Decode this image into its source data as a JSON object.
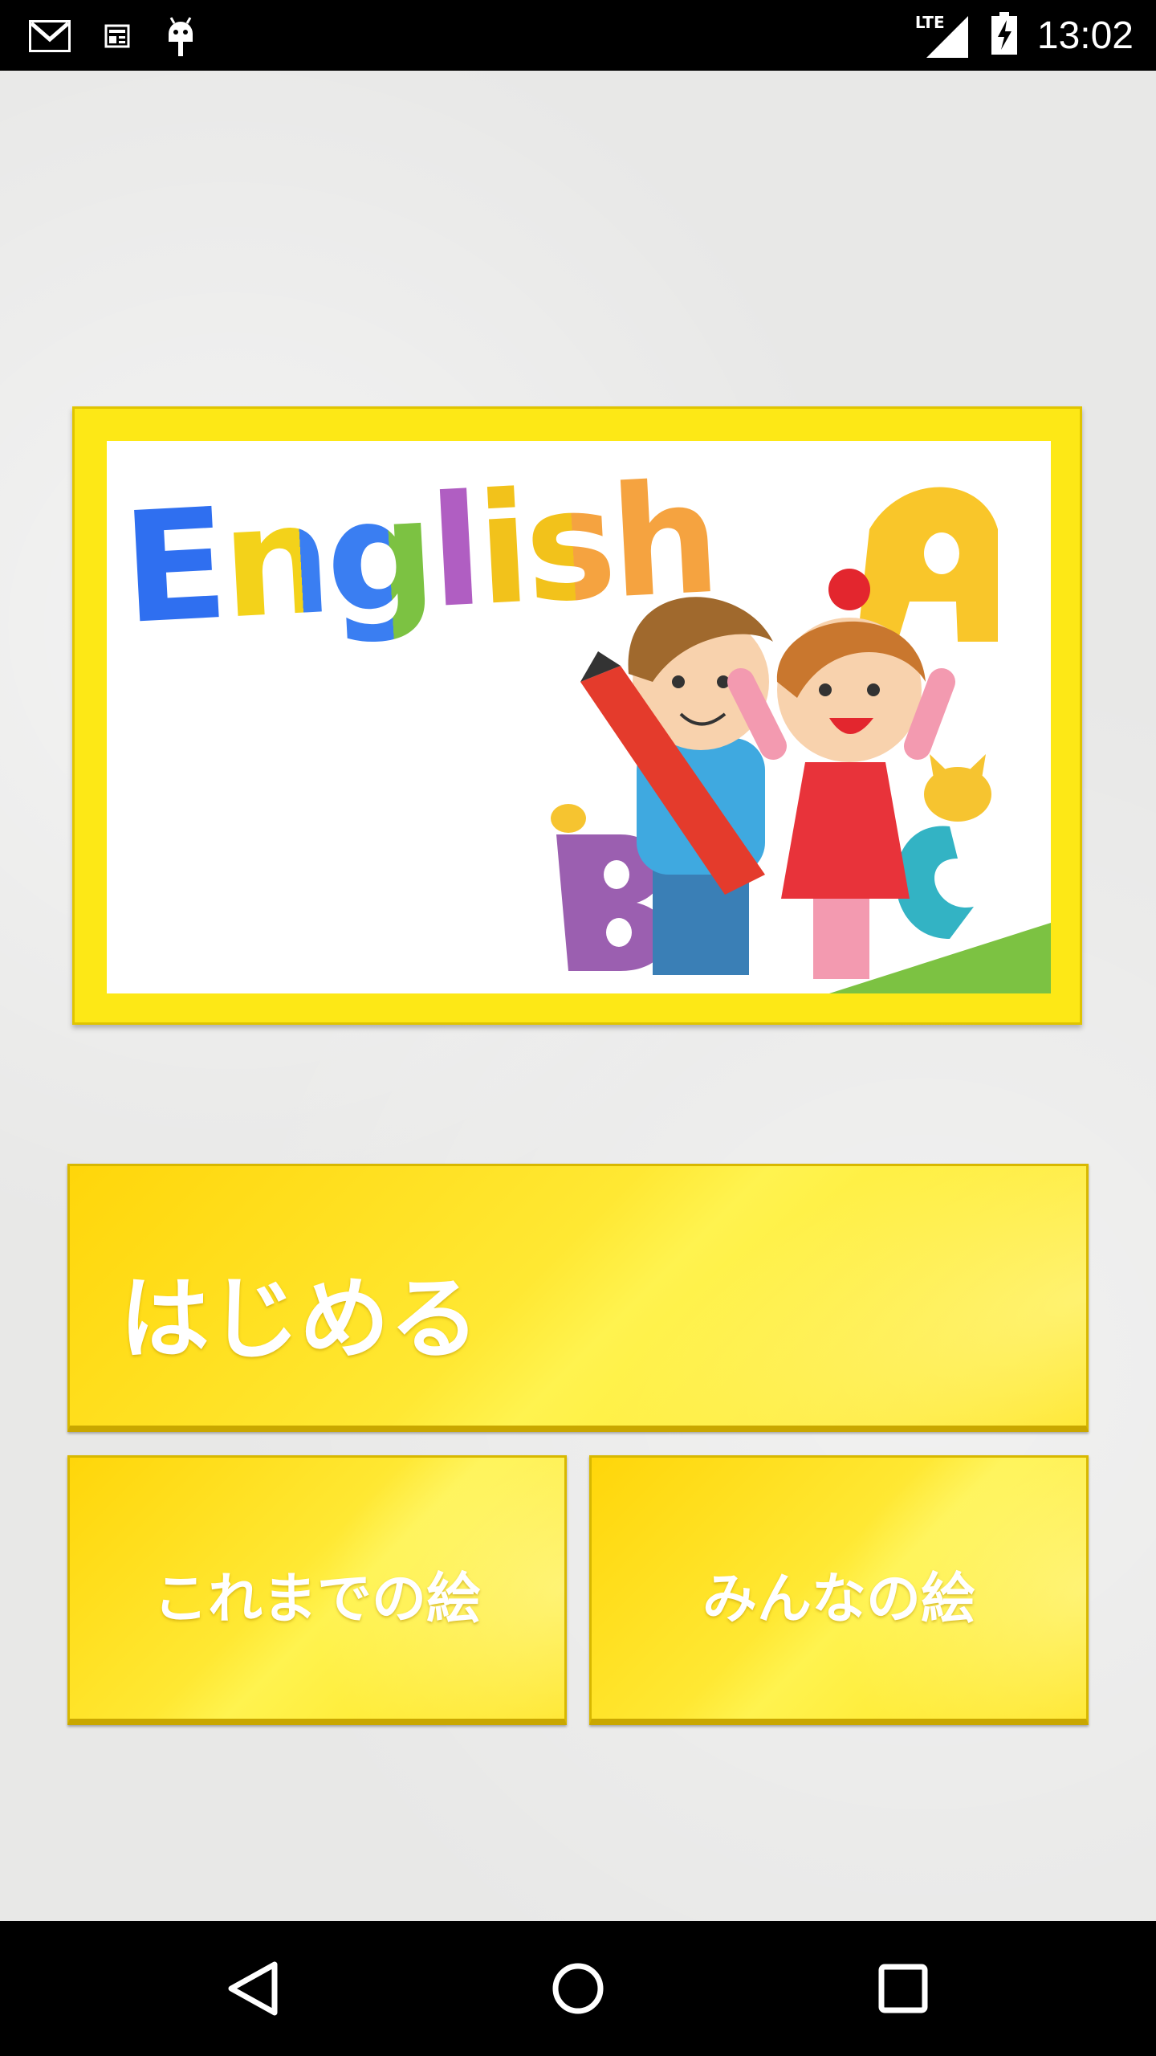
{
  "status_bar": {
    "time": "13:02",
    "network": "LTE",
    "icons": [
      "gmail-icon",
      "news-icon",
      "android-icon",
      "lte-signal-icon",
      "battery-charging-icon"
    ]
  },
  "banner": {
    "title_text": "English",
    "title_colors": [
      "#2f6ff0",
      "#34a0e8",
      "#f3d21a",
      "#3a7ef2",
      "#7cc242",
      "#b05ec2",
      "#f2c21b",
      "#f5a340"
    ]
  },
  "buttons": {
    "start_label": "はじめる",
    "past_drawings_label": "これまでの絵",
    "everyones_drawings_label": "みんなの絵"
  },
  "colors": {
    "accent_yellow": "#ffe41c",
    "button_border": "#d8b800"
  },
  "nav_bar": {
    "icons": [
      "back-icon",
      "home-icon",
      "recents-icon"
    ]
  }
}
